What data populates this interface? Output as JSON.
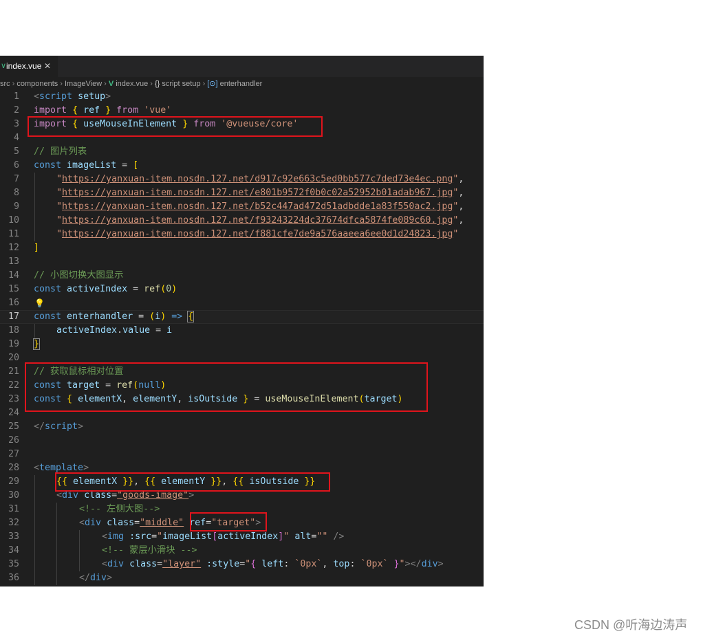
{
  "tab": {
    "label": "index.vue",
    "close": "✕"
  },
  "breadcrumb": {
    "items": [
      "src",
      "components",
      "ImageView",
      "index.vue",
      "script setup",
      "enterhandler"
    ]
  },
  "editor": {
    "current_line": 17,
    "lines": [
      {
        "n": "1"
      },
      {
        "n": "2"
      },
      {
        "n": "3"
      },
      {
        "n": "4"
      },
      {
        "n": "5"
      },
      {
        "n": "6"
      },
      {
        "n": "7"
      },
      {
        "n": "8"
      },
      {
        "n": "9"
      },
      {
        "n": "10"
      },
      {
        "n": "11"
      },
      {
        "n": "12"
      },
      {
        "n": "13"
      },
      {
        "n": "14"
      },
      {
        "n": "15"
      },
      {
        "n": "16"
      },
      {
        "n": "17"
      },
      {
        "n": "18"
      },
      {
        "n": "19"
      },
      {
        "n": "20"
      },
      {
        "n": "21"
      },
      {
        "n": "22"
      },
      {
        "n": "23"
      },
      {
        "n": "24"
      },
      {
        "n": "25"
      },
      {
        "n": "26"
      },
      {
        "n": "27"
      },
      {
        "n": "28"
      },
      {
        "n": "29"
      },
      {
        "n": "30"
      },
      {
        "n": "31"
      },
      {
        "n": "32"
      },
      {
        "n": "33"
      },
      {
        "n": "34"
      },
      {
        "n": "35"
      },
      {
        "n": "36"
      }
    ],
    "code": {
      "l1_tag": "script",
      "l1_attr": "setup",
      "import": "import",
      "from": "from",
      "ref": "ref",
      "vue": "'vue'",
      "useMouseInElement": "useMouseInElement",
      "vueuse": "'@vueuse/core'",
      "comment_images": "// 图片列表",
      "const": "const",
      "imageList": "imageList",
      "urls": [
        "https://yanxuan-item.nosdn.127.net/d917c92e663c5ed0bb577c7ded73e4ec.png",
        "https://yanxuan-item.nosdn.127.net/e801b9572f0b0c02a52952b01adab967.jpg",
        "https://yanxuan-item.nosdn.127.net/b52c447ad472d51adbdde1a83f550ac2.jpg",
        "https://yanxuan-item.nosdn.127.net/f93243224dc37674dfca5874fe089c60.jpg",
        "https://yanxuan-item.nosdn.127.net/f881cfe7de9a576aaeea6ee0d1d24823.jpg"
      ],
      "comment_switch": "// 小图切换大图显示",
      "activeIndex": "activeIndex",
      "zero": "0",
      "enterhandler": "enterhandler",
      "i": "i",
      "value": "value",
      "comment_mouse": "// 获取鼠标相对位置",
      "target": "target",
      "null": "null",
      "elementX": "elementX",
      "elementY": "elementY",
      "isOutside": "isOutside",
      "template": "template",
      "div": "div",
      "class": "class",
      "goods_image": "\"goods-image\"",
      "comment_left": "<!-- 左侧大图-->",
      "middle": "\"middle\"",
      "ref_attr": "ref",
      "target_str": "\"target\"",
      "img": "img",
      "src_attr": ":src",
      "src_val": "\"imageList[activeIndex]\"",
      "alt": "alt",
      "empty_str": "\"\"",
      "comment_layer": "<!-- 蒙层小滑块 -->",
      "layer": "\"layer\"",
      "style_attr": ":style",
      "left": "left",
      "top": "top",
      "px0": "`0px`"
    }
  },
  "watermark": "CSDN @听海边涛声"
}
